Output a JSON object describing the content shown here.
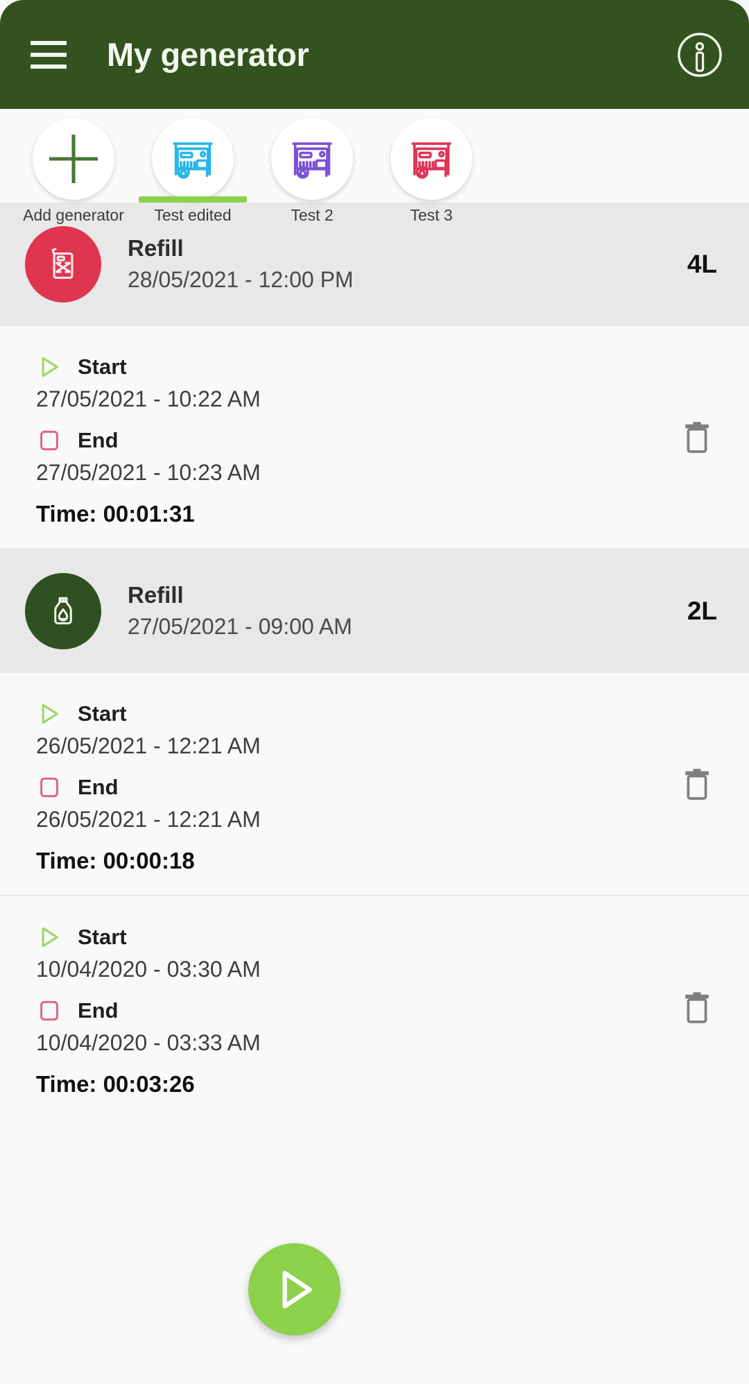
{
  "appbar": {
    "title": "My generator",
    "menu_icon": "hamburger-menu-icon",
    "info_icon": "info-circle-icon",
    "background_color": "#34521F"
  },
  "tabs": [
    {
      "label": "Add generator",
      "icon": "plus-icon",
      "color": "#4A7636",
      "active": false
    },
    {
      "label": "Test edited",
      "icon": "generator-icon",
      "color": "#29B6E8",
      "active": true
    },
    {
      "label": "Test 2",
      "icon": "generator-icon",
      "color": "#7B52D3",
      "active": false
    },
    {
      "label": "Test 3",
      "icon": "generator-icon",
      "color": "#E0345A",
      "active": false
    }
  ],
  "tab_indicator_color": "#8BD24A",
  "feed": [
    {
      "kind": "refill",
      "title": "Refill",
      "date": "28/05/2021 - 12:00 PM",
      "amount": "4L",
      "badge_color": "#E0354E",
      "badge_icon": "fuel-can-icon"
    },
    {
      "kind": "session",
      "start_label": "Start",
      "start_date": "27/05/2021 - 10:22 AM",
      "end_label": "End",
      "end_date": "27/05/2021 - 10:23 AM",
      "duration": "Time: 00:01:31",
      "start_icon": "play-triangle-icon",
      "end_icon": "stop-square-icon",
      "delete_icon": "trash-icon"
    },
    {
      "kind": "refill",
      "title": "Refill",
      "date": "27/05/2021 - 09:00 AM",
      "amount": "2L",
      "badge_color": "#2F5021",
      "badge_icon": "oil-bottle-icon"
    },
    {
      "kind": "session",
      "start_label": "Start",
      "start_date": "26/05/2021 - 12:21 AM",
      "end_label": "End",
      "end_date": "26/05/2021 - 12:21 AM",
      "duration": "Time: 00:00:18",
      "start_icon": "play-triangle-icon",
      "end_icon": "stop-square-icon",
      "delete_icon": "trash-icon"
    },
    {
      "kind": "session",
      "start_label": "Start",
      "start_date": "10/04/2020 - 03:30 AM",
      "end_label": "End",
      "end_date": "10/04/2020 - 03:33 AM",
      "duration": "Time: 00:03:26",
      "start_icon": "play-triangle-icon",
      "end_icon": "stop-square-icon",
      "delete_icon": "trash-icon"
    }
  ],
  "fab": {
    "icon": "play-triangle-icon",
    "color": "#8BD24A"
  },
  "colors": {
    "refill_row_background": "#E8E8E8",
    "session_row_background": "#F9F9F9",
    "start_icon": "#8BD24A",
    "end_icon": "#E0657F",
    "trash_icon": "#7E7E7E"
  }
}
